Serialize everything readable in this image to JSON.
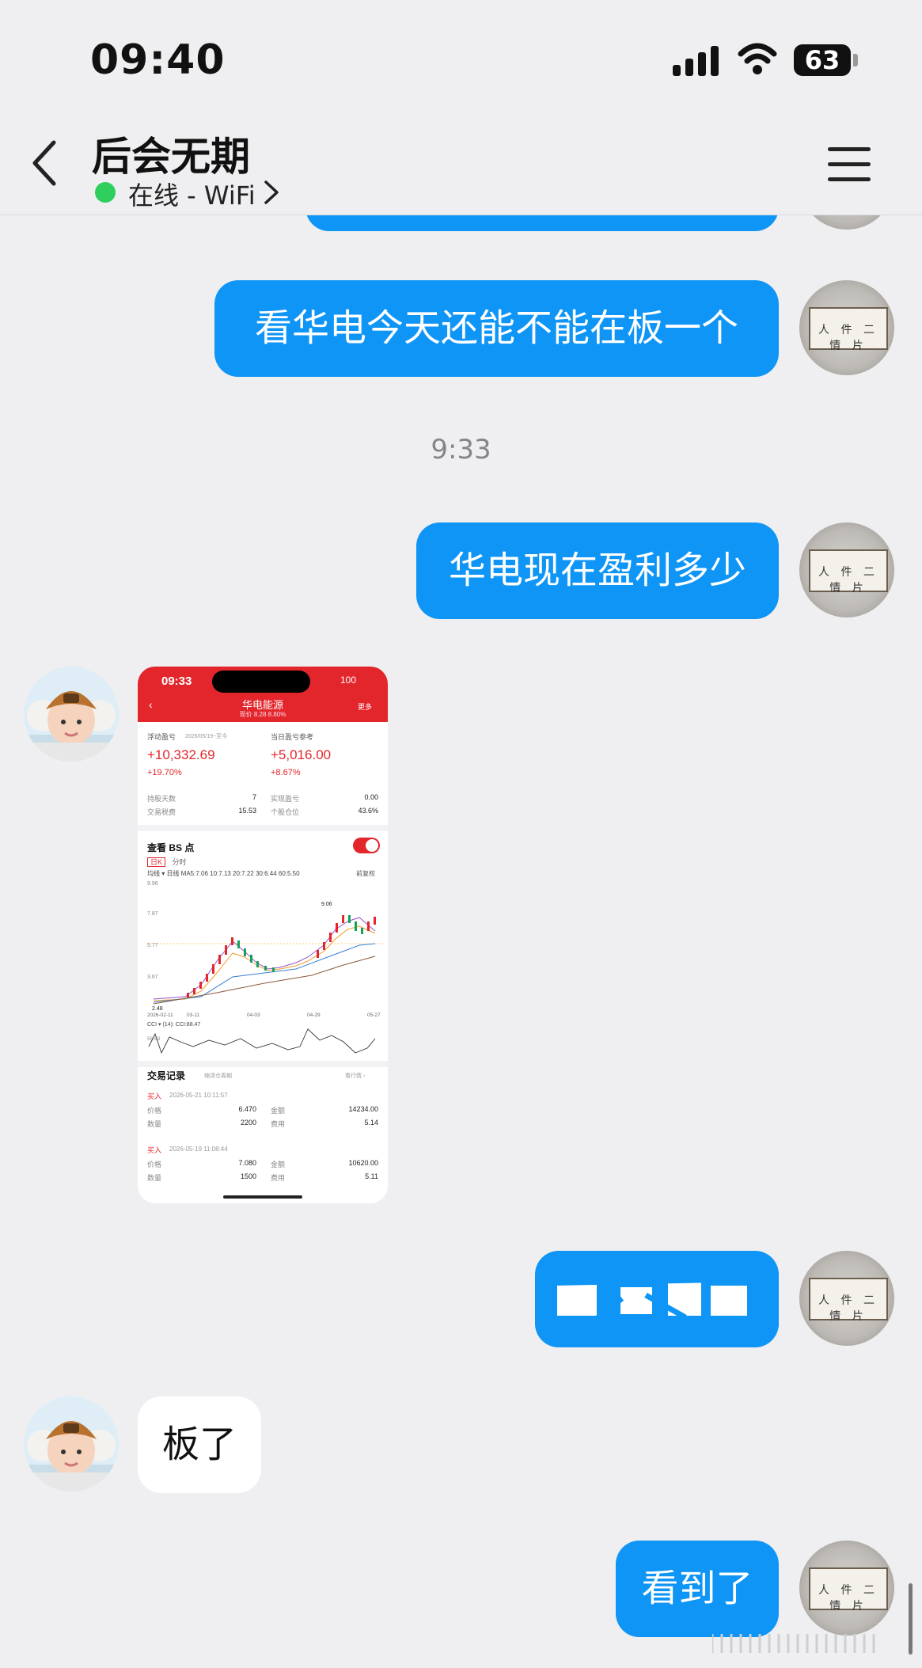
{
  "status_bar": {
    "time": "09:40",
    "battery": "63"
  },
  "header": {
    "contact_name": "后会无期",
    "status": "在线 - WiFi"
  },
  "messages": {
    "m1": "看华电今天还能不能在板一个",
    "timestamp": "9:33",
    "m2": "华电现在盈利多少",
    "m4": "板了",
    "m5": "看到了"
  },
  "shared_screenshot": {
    "time": "09:33",
    "battery": "100",
    "stock_name": "华电能源",
    "price_line": "现价 8.28 8.80%",
    "more": "更多",
    "float_pl_label": "浮动盈亏",
    "float_pl_date": "2026/05/19~至今",
    "float_pl_value": "+10,332.69",
    "float_pl_pct": "+19.70%",
    "day_pl_label": "当日盈亏参考",
    "day_pl_value": "+5,016.00",
    "day_pl_pct": "+8.67%",
    "hold_days_label": "持股天数",
    "hold_days": "7",
    "realized_label": "实现盈亏",
    "realized": "0.00",
    "fee_label": "交易税费",
    "fee": "15.53",
    "position_label": "个股仓位",
    "position": "43.6%",
    "bs_title": "查看 BS 点",
    "tab_day": "日K",
    "tab_min": "分时",
    "ma_line": "均线 ▾  日线  MA5:7.06  10:7.13  20:7.22  30:6.44  60:5.50",
    "adjust": "前复权",
    "y_ticks": [
      "9.96",
      "7.87",
      "5.77",
      "3.67"
    ],
    "high_marker": "9.06",
    "low_marker": "2.48",
    "x_ticks": [
      "2026-02-11",
      "03-11",
      "04-03",
      "04-29",
      "05-27"
    ],
    "cci_label": "CCI ▾   (14): CCI:88.47",
    "cci_tick": "56.63",
    "trades_title": "交易记录",
    "trades_filter": "缩清仓周期",
    "trades_more": "看行情 ›",
    "trades": [
      {
        "side": "买入",
        "time": "2026-05-21 10:11:57",
        "price_label": "价格",
        "price": "6.470",
        "amount_label": "金额",
        "amount": "14234.00",
        "qty_label": "数量",
        "qty": "2200",
        "cost_label": "费用",
        "cost": "5.14"
      },
      {
        "side": "买入",
        "time": "2026-05-19 11:08:44",
        "price_label": "价格",
        "price": "7.080",
        "amount_label": "金额",
        "amount": "10620.00",
        "qty_label": "数量",
        "qty": "1500",
        "cost_label": "费用",
        "cost": "5.11"
      }
    ]
  }
}
